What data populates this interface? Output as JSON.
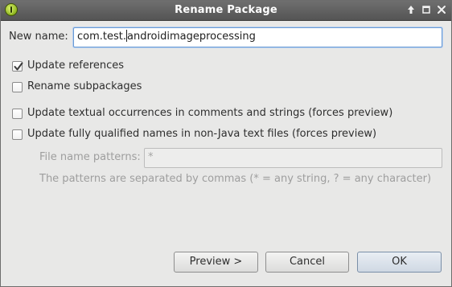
{
  "window": {
    "title": "Rename Package",
    "controls": [
      "up-arrow-icon",
      "maximize-icon",
      "close-icon"
    ]
  },
  "new_name": {
    "label": "New name:",
    "value_before_caret": "com.test.",
    "value_after_caret": "androidimageprocessing"
  },
  "options": {
    "update_references": {
      "label": "Update references",
      "checked": true
    },
    "rename_subpackages": {
      "label": "Rename subpackages",
      "checked": false
    },
    "update_textual": {
      "label": "Update textual occurrences in comments and strings (forces preview)",
      "checked": false
    },
    "update_qualified": {
      "label": "Update fully qualified names in non-Java text files (forces preview)",
      "checked": false
    }
  },
  "file_patterns": {
    "label": "File name patterns:",
    "value": "*",
    "hint": "The patterns are separated by commas (* = any string, ? = any character)"
  },
  "buttons": {
    "preview": "Preview >",
    "cancel": "Cancel",
    "ok": "OK"
  },
  "colors": {
    "titlebar": "#5e5e5e",
    "dialog_bg": "#e8e8e7",
    "focus_border": "#6a9bd5",
    "app_icon": "#8fb620"
  }
}
